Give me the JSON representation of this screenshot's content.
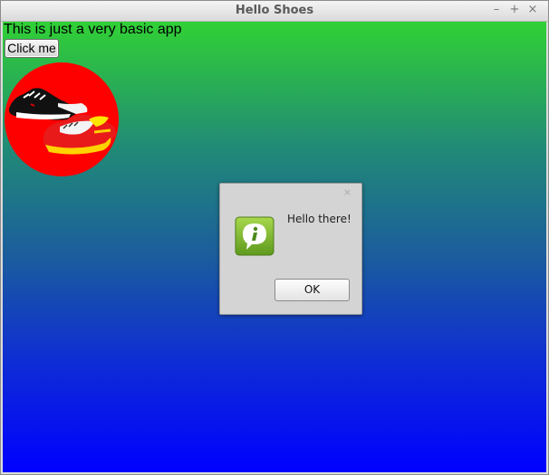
{
  "window": {
    "title": "Hello Shoes",
    "controls": {
      "minimize": "–",
      "maximize": "+",
      "close": "×"
    }
  },
  "content": {
    "text": "This is just a very basic app",
    "button_label": "Click me",
    "background_top": "#31d135",
    "background_bottom": "#0000ff"
  },
  "logo": {
    "icon": "shoes-logo-icon",
    "circle_color": "#ff0000"
  },
  "dialog": {
    "close": "×",
    "icon": "info-icon",
    "message": "Hello there!",
    "ok_label": "OK"
  }
}
